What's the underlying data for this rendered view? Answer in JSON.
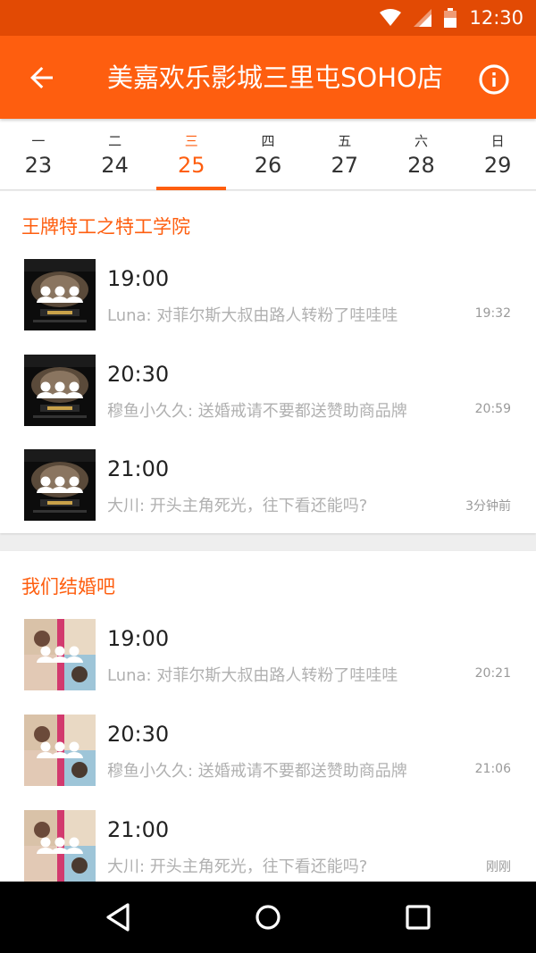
{
  "status_bar": {
    "time": "12:30",
    "icons": [
      "wifi-icon",
      "cell-signal-icon",
      "battery-icon"
    ]
  },
  "app_bar": {
    "title": "美嘉欢乐影城三里屯SOHO店",
    "back_icon": "arrow-back-icon",
    "info_icon": "info-icon"
  },
  "date_tabs": [
    {
      "dow": "一",
      "day": "23",
      "active": false
    },
    {
      "dow": "二",
      "day": "24",
      "active": false
    },
    {
      "dow": "三",
      "day": "25",
      "active": true
    },
    {
      "dow": "四",
      "day": "26",
      "active": false
    },
    {
      "dow": "五",
      "day": "27",
      "active": false
    },
    {
      "dow": "六",
      "day": "28",
      "active": false
    },
    {
      "dow": "日",
      "day": "29",
      "active": false
    }
  ],
  "movies": [
    {
      "title": "王牌特工之特工学院",
      "showtimes": [
        {
          "time": "19:00",
          "comment": "Luna: 对菲尔斯大叔由路人转粉了哇哇哇",
          "stamp": "19:32"
        },
        {
          "time": "20:30",
          "comment": "穆鱼小久久: 送婚戒请不要都送赞助商品牌",
          "stamp": "20:59"
        },
        {
          "time": "21:00",
          "comment": "大川: 开头主角死光，往下看还能吗?",
          "stamp": "3分钟前"
        }
      ]
    },
    {
      "title": "我们结婚吧",
      "showtimes": [
        {
          "time": "19:00",
          "comment": "Luna: 对菲尔斯大叔由路人转粉了哇哇哇",
          "stamp": "20:21"
        },
        {
          "time": "20:30",
          "comment": "穆鱼小久久: 送婚戒请不要都送赞助商品牌",
          "stamp": "21:06"
        },
        {
          "time": "21:00",
          "comment": "大川: 开头主角死光，往下看还能吗?",
          "stamp": "刚刚"
        }
      ]
    }
  ],
  "nav_bar": {
    "icons": [
      "nav-back-icon",
      "nav-home-icon",
      "nav-recents-icon"
    ]
  },
  "colors": {
    "accent": "#fe5e0f",
    "status_bar": "#e24a04"
  }
}
